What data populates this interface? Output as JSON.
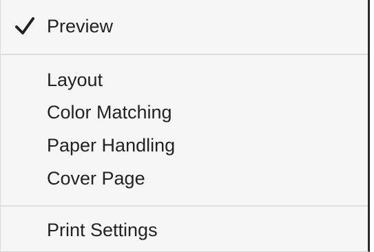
{
  "menu": {
    "items": [
      {
        "label": "Preview",
        "checked": true
      },
      {
        "label": "Layout"
      },
      {
        "label": "Color Matching"
      },
      {
        "label": "Paper Handling"
      },
      {
        "label": "Cover Page"
      },
      {
        "label": "Print Settings"
      }
    ],
    "check_icon": "checkmark-icon"
  }
}
